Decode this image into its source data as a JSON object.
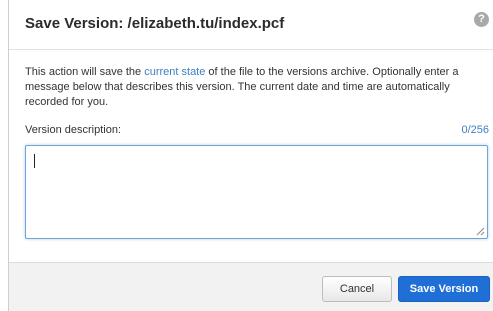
{
  "dialog": {
    "title": "Save Version: /elizabeth.tu/index.pcf",
    "help_icon": "question-circle-icon",
    "description_before_link": "This action will save the ",
    "description_link": "current state",
    "description_after_link": " of the file to the versions archive. Optionally enter a message below that describes this version. The current date and time are automatically recorded for you.",
    "field_label": "Version description:",
    "char_counter": "0/256",
    "textarea_value": "",
    "cancel_label": "Cancel",
    "save_label": "Save Version"
  },
  "colors": {
    "link": "#3d7fc4",
    "primary_button": "#1f6fd6",
    "textarea_focus_border": "#74a3d9",
    "footer_bg": "#f2f2f2"
  }
}
